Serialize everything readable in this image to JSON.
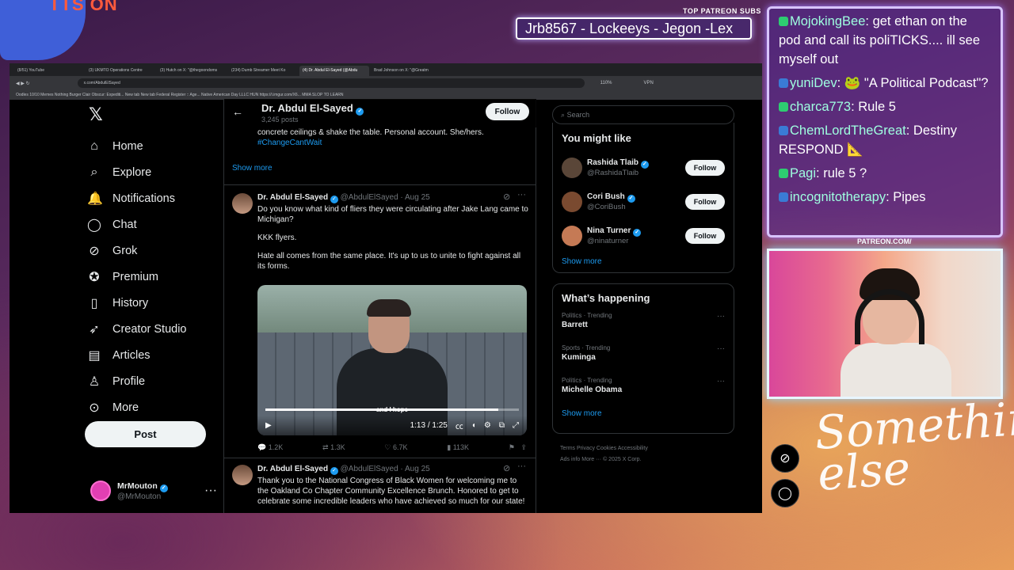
{
  "overlay": {
    "logo": "TTS ON",
    "patreon_label": "TOP PATREON SUBS",
    "patreon_subs": "Jrb8567 - Lockeeys - Jegon -Lex",
    "patreon_url": "PATREON.COM/",
    "signature": "Something else",
    "chat": [
      {
        "user": "MojokingBee",
        "text": "get ethan on the pod and call its poliTICKS.... ill see myself out",
        "color": "#9fffe0"
      },
      {
        "user": "yuniDev",
        "text": "🐸 \"A Political Podcast\"?",
        "color": "#9fffe0"
      },
      {
        "user": "charca773",
        "text": "Rule 5",
        "color": "#9fffe0"
      },
      {
        "user": "ChemLordTheGreat",
        "text": "Destiny RESPOND 📐",
        "color": "#9fffe0"
      },
      {
        "user": "Pagi",
        "text": "rule 5 ?",
        "color": "#9fffe0"
      },
      {
        "user": "incognitotherapy",
        "text": "Pipes",
        "color": "#9fffe0"
      }
    ]
  },
  "browser": {
    "tabs": [
      "(8/51) YouTube",
      "(3) UKMTO Operations Centre",
      "(3) Hutch on X: \"@thegoondoms",
      "(234) Dumb Streamer Meet Ko",
      "(4) Dr. Abdul El-Sayed (@Abdu",
      "Brad Johnson on X: \"@Greatm"
    ],
    "active_tab": 4,
    "url": "x.com/AbdulElSayed",
    "zoom": "110%",
    "vpn": "VPN",
    "bookmarks": "Oodles   10/10 Memes   Nothing Burger   Clair Obscur: Expediti...   New tab   New tab   Federal Register :: Age...   Native American Day   LLLC HUN   https://i.imgur.com/X6...   MMA SLOP TO LEARN"
  },
  "nav": {
    "items": [
      {
        "label": "Home",
        "icon": "⌂",
        "name": "home"
      },
      {
        "label": "Explore",
        "icon": "⌕",
        "name": "explore"
      },
      {
        "label": "Notifications",
        "icon": "🔔",
        "name": "notifications"
      },
      {
        "label": "Chat",
        "icon": "◯",
        "name": "chat"
      },
      {
        "label": "Grok",
        "icon": "⊘",
        "name": "grok"
      },
      {
        "label": "Premium",
        "icon": "✪",
        "name": "premium"
      },
      {
        "label": "History",
        "icon": "▯",
        "name": "history"
      },
      {
        "label": "Creator Studio",
        "icon": "➶",
        "name": "creator-studio"
      },
      {
        "label": "Articles",
        "icon": "▤",
        "name": "articles"
      },
      {
        "label": "Profile",
        "icon": "♙",
        "name": "profile"
      },
      {
        "label": "More",
        "icon": "⊙",
        "name": "more"
      }
    ],
    "post": "Post",
    "me": {
      "name": "MrMouton",
      "handle": "@MrMouton"
    }
  },
  "profile": {
    "name": "Dr. Abdul El-Sayed",
    "posts": "3,245 posts",
    "follow": "Follow",
    "bio": "concrete ceilings & shake the table. Personal account. She/hers.",
    "hashtag": "#ChangeCantWait",
    "show_more": "Show more"
  },
  "tweets": [
    {
      "name": "Dr. Abdul El-Sayed",
      "handle": "@AbdulElSayed",
      "date": "Aug 25",
      "p1": "Do you know what kind of fliers they were circulating after Jake Lang came to Michigan?",
      "p2": "KKK flyers.",
      "p3": "Hate all comes from the same place. It's up to us to unite to fight against all its forms.",
      "caption": "and I hope",
      "time": "1:13 / 1:25",
      "progress": 0.92,
      "replies": "1.2K",
      "reposts": "1.3K",
      "likes": "6.7K",
      "views": "113K"
    },
    {
      "name": "Dr. Abdul El-Sayed",
      "handle": "@AbdulElSayed",
      "date": "Aug 25",
      "p1": "Thank you to the National Congress of Black Women for welcoming me to the Oakland Co Chapter Community Excellence Brunch. Honored to get to celebrate some incredible leaders who have achieved so much for our state!"
    }
  ],
  "right": {
    "search_placeholder": "Search",
    "you_might_like": "You might like",
    "people": [
      {
        "name": "Rashida Tlaib",
        "handle": "@RashidaTlaib",
        "color": "#5a4638"
      },
      {
        "name": "Cori Bush",
        "handle": "@CoriBush",
        "color": "#7a4a30"
      },
      {
        "name": "Nina Turner",
        "handle": "@ninaturner",
        "color": "#c57a55"
      }
    ],
    "follow": "Follow",
    "show_more": "Show more",
    "happening_title": "What’s happening",
    "trends": [
      {
        "cat": "Politics · Trending",
        "name": "Barrett"
      },
      {
        "cat": "Sports · Trending",
        "name": "Kuminga"
      },
      {
        "cat": "Politics · Trending",
        "name": "Michelle Obama"
      }
    ],
    "footer1": "Terms   Privacy   Cookies   Accessibility",
    "footer2": "Ads info   More ···   © 2025 X Corp."
  }
}
